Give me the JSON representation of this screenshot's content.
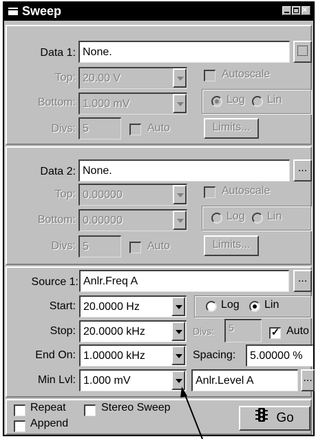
{
  "window": {
    "title": "Sweep"
  },
  "data1": {
    "label": "Data 1:",
    "value": "None.",
    "top_label": "Top:",
    "top_value": "20.00   V",
    "bottom_label": "Bottom:",
    "bottom_value": "1.000   mV",
    "divs_label": "Divs:",
    "divs_value": "5",
    "auto_label": "Auto",
    "autoscale_label": "Autoscale",
    "log_label": "Log",
    "lin_label": "Lin",
    "limits_label": "Limits..."
  },
  "data2": {
    "label": "Data 2:",
    "value": "None.",
    "browse_label": "...",
    "top_label": "Top:",
    "top_value": "0.00000",
    "bottom_label": "Bottom:",
    "bottom_value": "0.00000",
    "divs_label": "Divs:",
    "divs_value": "5",
    "auto_label": "Auto",
    "autoscale_label": "Autoscale",
    "log_label": "Log",
    "lin_label": "Lin",
    "limits_label": "Limits..."
  },
  "source1": {
    "label": "Source 1:",
    "value": "Anlr.Freq A",
    "browse_label": "...",
    "start_label": "Start:",
    "start_value": "20.0000  Hz",
    "stop_label": "Stop:",
    "stop_value": "20.0000 kHz",
    "endon_label": "End On:",
    "endon_value": "1.00000 kHz",
    "minlvl_label": "Min Lvl:",
    "minlvl_value": "1.000   mV",
    "log_label": "Log",
    "lin_label": "Lin",
    "divs_label": "Divs:",
    "divs_value": "5",
    "auto_label": "Auto",
    "spacing_label": "Spacing:",
    "spacing_value": "5.00000  %",
    "level_value": "Anlr.Level A",
    "level_browse_label": "..."
  },
  "footer": {
    "repeat_label": "Repeat",
    "stereo_label": "Stereo Sweep",
    "append_label": "Append",
    "go_label": "Go"
  }
}
